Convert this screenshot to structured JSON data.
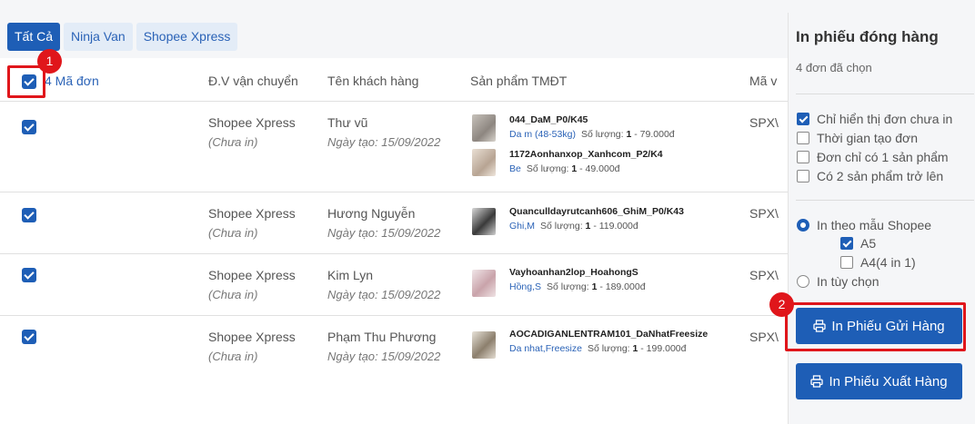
{
  "tabs": [
    {
      "label": "Tất Cả",
      "active": true
    },
    {
      "label": "Ninja Van",
      "active": false
    },
    {
      "label": "Shopee Xpress",
      "active": false
    }
  ],
  "table": {
    "headers": {
      "order": "4 Mã đơn",
      "carrier": "Đ.V vận chuyển",
      "customer": "Tên khách hàng",
      "products": "Sản phẩm TMĐT",
      "code": "Mã v"
    },
    "rows": [
      {
        "carrier": "Shopee Xpress",
        "print_status": "(Chưa in)",
        "customer": "Thư vũ",
        "created": "Ngày tạo: 15/09/2022",
        "code": "SPX\\",
        "products": [
          {
            "name": "044_DaM_P0/K45",
            "variant": "Da m (48-53kg)",
            "qty_label": "Số lượng:",
            "qty": "1",
            "price": "- 79.000đ"
          },
          {
            "name": "1172Aonhanxop_Xanhcom_P2/K4",
            "variant": "Be",
            "qty_label": "Số lượng:",
            "qty": "1",
            "price": "- 49.000đ"
          }
        ]
      },
      {
        "carrier": "Shopee Xpress",
        "print_status": "(Chưa in)",
        "customer": "Hương Nguyễn",
        "created": "Ngày tạo: 15/09/2022",
        "code": "SPX\\",
        "products": [
          {
            "name": "Quanculldayrutcanh606_GhiM_P0/K43",
            "variant": "Ghi,M",
            "qty_label": "Số lượng:",
            "qty": "1",
            "price": "- 119.000đ"
          }
        ]
      },
      {
        "carrier": "Shopee Xpress",
        "print_status": "(Chưa in)",
        "customer": "Kim Lyn",
        "created": "Ngày tạo: 15/09/2022",
        "code": "SPX\\",
        "products": [
          {
            "name": "Vayhoanhan2lop_HoahongS",
            "variant": "Hồng,S",
            "qty_label": "Số lượng:",
            "qty": "1",
            "price": "- 189.000đ"
          }
        ]
      },
      {
        "carrier": "Shopee Xpress",
        "print_status": "(Chưa in)",
        "customer": "Phạm Thu Phương",
        "created": "Ngày tạo: 15/09/2022",
        "code": "SPX\\",
        "products": [
          {
            "name": "AOCADIGANLENTRAM101_DaNhatFreesize",
            "variant": "Da nhat,Freesize",
            "qty_label": "Số lượng:",
            "qty": "1",
            "price": "- 199.000đ"
          }
        ]
      }
    ]
  },
  "side": {
    "title": "In phiếu đóng hàng",
    "selected": "4 đơn đã chọn",
    "filters": [
      {
        "label": "Chỉ hiển thị đơn chưa in",
        "checked": true
      },
      {
        "label": "Thời gian tạo đơn",
        "checked": false
      },
      {
        "label": "Đơn chỉ có 1 sản phẩm",
        "checked": false
      },
      {
        "label": "Có 2 sản phẩm trở lên",
        "checked": false
      }
    ],
    "print_shopee": "In theo mẫu Shopee",
    "size_a5": "A5",
    "size_a4": "A4(4 in 1)",
    "print_custom": "In tùy chọn",
    "btn_shipping": "In Phiếu Gửi Hàng",
    "btn_export": "In Phiếu Xuất Hàng"
  },
  "annotations": {
    "one": "1",
    "two": "2"
  },
  "colors": {
    "accent": "#1e5eb6",
    "highlight": "#e0161b"
  }
}
